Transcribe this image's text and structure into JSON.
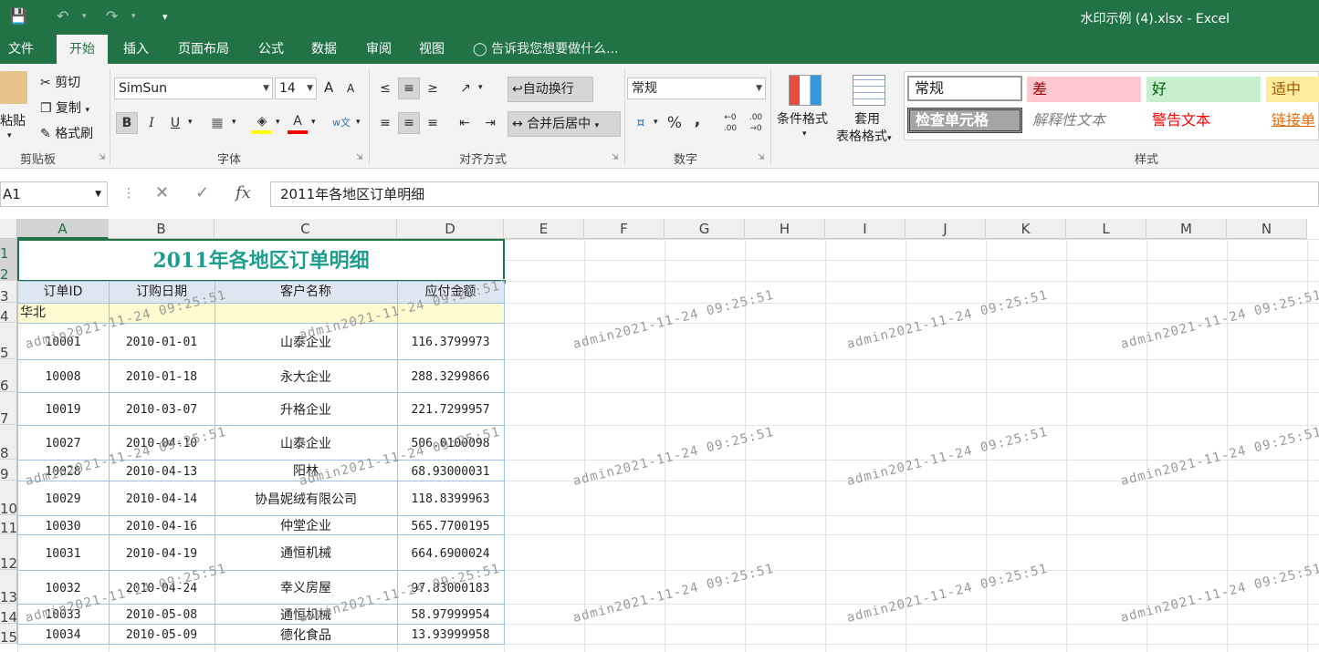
{
  "window": {
    "title": "水印示例 (4).xlsx  -  Excel"
  },
  "tabs": [
    "文件",
    "开始",
    "插入",
    "页面布局",
    "公式",
    "数据",
    "审阅",
    "视图"
  ],
  "active_tab": "开始",
  "tell_me": "告诉我您想要做什么...",
  "ribbon": {
    "clipboard": {
      "paste": "粘贴",
      "cut": "剪切",
      "copy": "复制",
      "format_painter": "格式刷",
      "label": "剪贴板"
    },
    "font": {
      "name": "SimSun",
      "size": "14",
      "grow": "A",
      "shrink": "A",
      "bold": "B",
      "italic": "I",
      "underline": "U",
      "font_color": "A",
      "label": "字体"
    },
    "alignment": {
      "wrap": "自动换行",
      "merge": "合并后居中",
      "label": "对齐方式"
    },
    "number": {
      "format": "常规",
      "percent": "%",
      "comma": ",",
      "label": "数字"
    },
    "styles": {
      "conditional": "条件格式",
      "table_format_line1": "套用",
      "table_format_line2": "表格格式",
      "cells": [
        "常规",
        "差",
        "好",
        "适中",
        "检查单元格",
        "解释性文本",
        "警告文本",
        "链接单"
      ],
      "label": "样式",
      "colors": {
        "normal": "#ffffff",
        "bad_bg": "#ffc7ce",
        "bad_fg": "#9c0006",
        "good_bg": "#c6efce",
        "good_fg": "#006100",
        "neutral_bg": "#ffeb9c",
        "neutral_fg": "#9c5700",
        "check_bg": "#a5a5a5",
        "warning_fg": "#ff0000",
        "link_fg": "#e36c09"
      }
    }
  },
  "formula_bar": {
    "name_box": "A1",
    "cancel": "✕",
    "enter": "✓",
    "fx": "fx",
    "content": "2011年各地区订单明细"
  },
  "columns": [
    "A",
    "B",
    "C",
    "D",
    "E",
    "F",
    "G",
    "H",
    "I",
    "J",
    "K",
    "L",
    "M",
    "N"
  ],
  "rows": [
    "1",
    "2",
    "3",
    "4",
    "5",
    "6",
    "7",
    "8",
    "9",
    "10",
    "11",
    "12",
    "13",
    "14",
    "15"
  ],
  "sheet_title": "2011年各地区订单明细",
  "table_headers": [
    "订单ID",
    "订购日期",
    "客户名称",
    "应付金额"
  ],
  "group_label": "华北",
  "records": [
    [
      "10001",
      "2010-01-01",
      "山泰企业",
      "116.3799973"
    ],
    [
      "10008",
      "2010-01-18",
      "永大企业",
      "288.3299866"
    ],
    [
      "10019",
      "2010-03-07",
      "升格企业",
      "221.7299957"
    ],
    [
      "10027",
      "2010-04-10",
      "山泰企业",
      "506.0100098"
    ],
    [
      "10028",
      "2010-04-13",
      "阳林",
      "68.93000031"
    ],
    [
      "10029",
      "2010-04-14",
      "协昌妮绒有限公司",
      "118.8399963"
    ],
    [
      "10030",
      "2010-04-16",
      "仲堂企业",
      "565.7700195"
    ],
    [
      "10031",
      "2010-04-19",
      "通恒机械",
      "664.6900024"
    ],
    [
      "10032",
      "2010-04-24",
      "幸义房屋",
      "97.83000183"
    ],
    [
      "10033",
      "2010-05-08",
      "通恒机械",
      "58.97999954"
    ],
    [
      "10034",
      "2010-05-09",
      "德化食品",
      "13.93999958"
    ]
  ],
  "watermark_text": "admin2021-11-24 09:25:51",
  "colors": {
    "accent": "#217346",
    "title_text": "#1f9e8f",
    "group_fill": "#fffbd1",
    "header_fill": "#dde6f1",
    "table_border": "#9dc3e6"
  }
}
